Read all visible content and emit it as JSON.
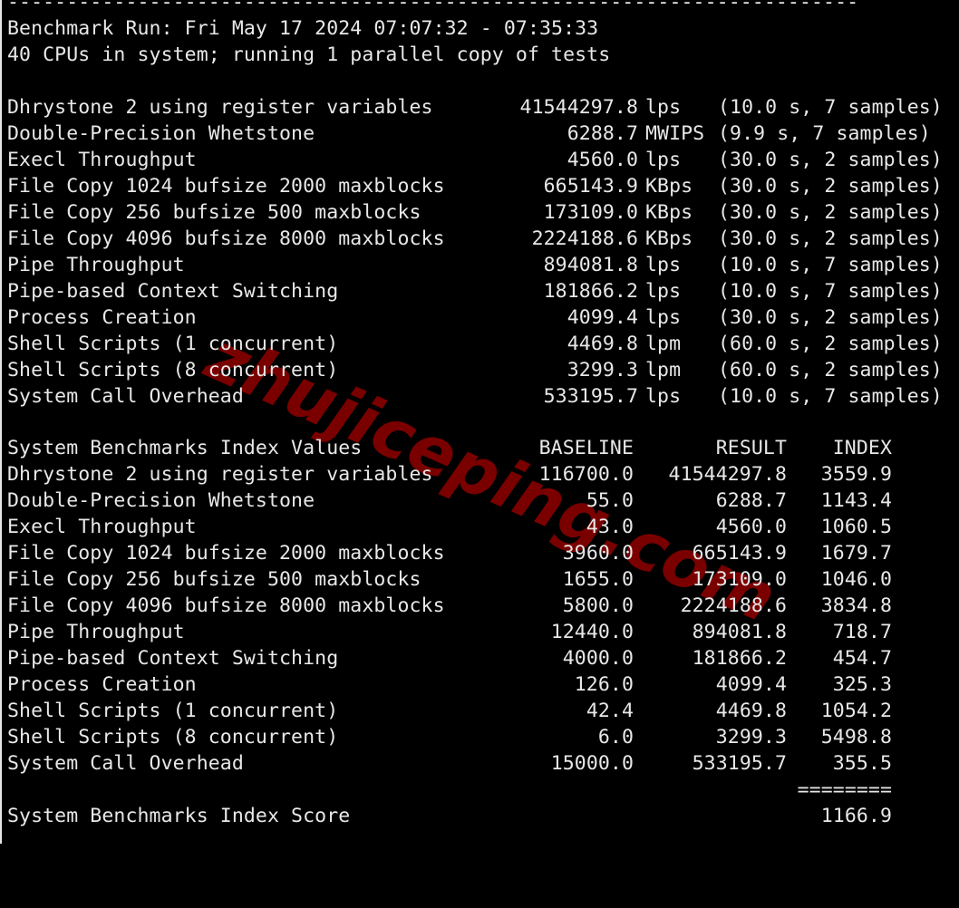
{
  "terminal": {
    "separator": "------------------------------------------------------------------------",
    "run_line": "Benchmark Run: Fri May 17 2024 07:07:32 - 07:35:33",
    "cpu_line": "40 CPUs in system; running 1 parallel copy of tests",
    "watermark": "zhujiceping.com",
    "colors": {
      "background": "#000000",
      "text": "#e8e8e8",
      "watermark": "#7a0000"
    },
    "results": [
      {
        "name": "Dhrystone 2 using register variables",
        "value": "41544297.8",
        "unit": "lps",
        "detail": "(10.0 s, 7 samples)"
      },
      {
        "name": "Double-Precision Whetstone",
        "value": "6288.7",
        "unit": "MWIPS",
        "detail": "(9.9 s, 7 samples)"
      },
      {
        "name": "Execl Throughput",
        "value": "4560.0",
        "unit": "lps",
        "detail": "(30.0 s, 2 samples)"
      },
      {
        "name": "File Copy 1024 bufsize 2000 maxblocks",
        "value": "665143.9",
        "unit": "KBps",
        "detail": "(30.0 s, 2 samples)"
      },
      {
        "name": "File Copy 256 bufsize 500 maxblocks",
        "value": "173109.0",
        "unit": "KBps",
        "detail": "(30.0 s, 2 samples)"
      },
      {
        "name": "File Copy 4096 bufsize 8000 maxblocks",
        "value": "2224188.6",
        "unit": "KBps",
        "detail": "(30.0 s, 2 samples)"
      },
      {
        "name": "Pipe Throughput",
        "value": "894081.8",
        "unit": "lps",
        "detail": "(10.0 s, 7 samples)"
      },
      {
        "name": "Pipe-based Context Switching",
        "value": "181866.2",
        "unit": "lps",
        "detail": "(10.0 s, 7 samples)"
      },
      {
        "name": "Process Creation",
        "value": "4099.4",
        "unit": "lps",
        "detail": "(30.0 s, 2 samples)"
      },
      {
        "name": "Shell Scripts (1 concurrent)",
        "value": "4469.8",
        "unit": "lpm",
        "detail": "(60.0 s, 2 samples)"
      },
      {
        "name": "Shell Scripts (8 concurrent)",
        "value": "3299.3",
        "unit": "lpm",
        "detail": "(60.0 s, 2 samples)"
      },
      {
        "name": "System Call Overhead",
        "value": "533195.7",
        "unit": "lps",
        "detail": "(10.0 s, 7 samples)"
      }
    ],
    "index_header": {
      "title": "System Benchmarks Index Values",
      "baseline": "BASELINE",
      "result": "RESULT",
      "index": "INDEX"
    },
    "index_rows": [
      {
        "name": "Dhrystone 2 using register variables",
        "baseline": "116700.0",
        "result": "41544297.8",
        "index": "3559.9"
      },
      {
        "name": "Double-Precision Whetstone",
        "baseline": "55.0",
        "result": "6288.7",
        "index": "1143.4"
      },
      {
        "name": "Execl Throughput",
        "baseline": "43.0",
        "result": "4560.0",
        "index": "1060.5"
      },
      {
        "name": "File Copy 1024 bufsize 2000 maxblocks",
        "baseline": "3960.0",
        "result": "665143.9",
        "index": "1679.7"
      },
      {
        "name": "File Copy 256 bufsize 500 maxblocks",
        "baseline": "1655.0",
        "result": "173109.0",
        "index": "1046.0"
      },
      {
        "name": "File Copy 4096 bufsize 8000 maxblocks",
        "baseline": "5800.0",
        "result": "2224188.6",
        "index": "3834.8"
      },
      {
        "name": "Pipe Throughput",
        "baseline": "12440.0",
        "result": "894081.8",
        "index": "718.7"
      },
      {
        "name": "Pipe-based Context Switching",
        "baseline": "4000.0",
        "result": "181866.2",
        "index": "454.7"
      },
      {
        "name": "Process Creation",
        "baseline": "126.0",
        "result": "4099.4",
        "index": "325.3"
      },
      {
        "name": "Shell Scripts (1 concurrent)",
        "baseline": "42.4",
        "result": "4469.8",
        "index": "1054.2"
      },
      {
        "name": "Shell Scripts (8 concurrent)",
        "baseline": "6.0",
        "result": "3299.3",
        "index": "5498.8"
      },
      {
        "name": "System Call Overhead",
        "baseline": "15000.0",
        "result": "533195.7",
        "index": "355.5"
      }
    ],
    "score_rule": "========",
    "score_label": "System Benchmarks Index Score",
    "score_value": "1166.9"
  }
}
